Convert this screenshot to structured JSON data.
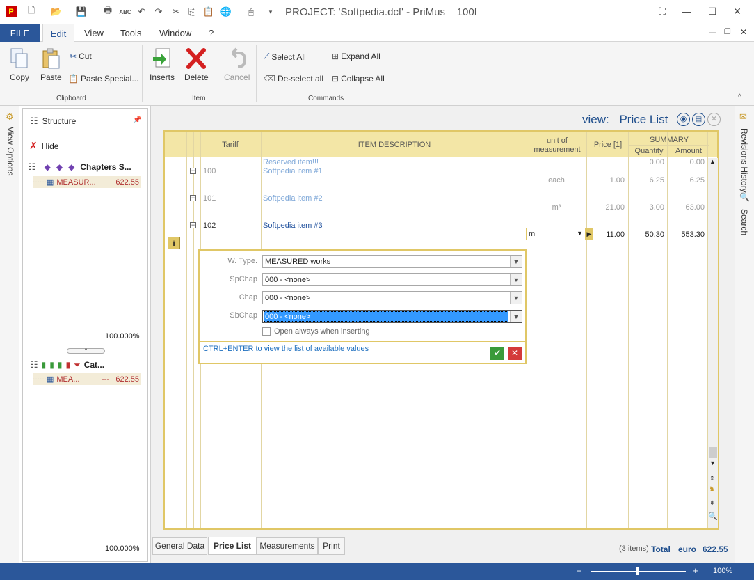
{
  "app": {
    "title": "PROJECT: 'Softpedia.dcf' - PriMus    100f"
  },
  "menu": {
    "file": "FILE",
    "tabs": [
      "Edit",
      "View",
      "Tools",
      "Window",
      "?"
    ]
  },
  "ribbon": {
    "copy": "Copy",
    "paste": "Paste",
    "cut": "Cut",
    "paste_special": "Paste Special...",
    "clipboard_group": "Clipboard",
    "inserts": "Inserts",
    "delete": "Delete",
    "cancel": "Cancel",
    "item_group": "Item",
    "select_all": "Select All",
    "deselect_all": "De-select all",
    "expand_all": "Expand All",
    "collapse_all": "Collapse All",
    "commands_group": "Commands"
  },
  "left_strip": {
    "view_options": "View Options"
  },
  "left_panel": {
    "structure": "Structure",
    "hide": "Hide",
    "chapters": "Chapters S...",
    "measur_label": "MEASUR...",
    "measur_value": "622.55",
    "percent_top": "100.000%",
    "cat": "Cat...",
    "mea_label": "MEA...",
    "mea_dash": "---",
    "mea_value": "622.55",
    "percent_bottom": "100.000%"
  },
  "right_strip": {
    "revisions": "Revisions History",
    "search": "Search"
  },
  "view": {
    "label": "view:",
    "name": "Price List"
  },
  "grid": {
    "headers": {
      "tariff": "Tariff",
      "description": "ITEM DESCRIPTION",
      "unit_line1": "unit of",
      "unit_line2": "measurement",
      "price": "Price [1]",
      "summary": "SUMMARY",
      "quantity": "Quantity",
      "amount": "Amount"
    },
    "rows": [
      {
        "tariff": "",
        "desc": "Reserved item!!!",
        "unit": "",
        "price": "",
        "qty": "0.00",
        "amount": "0.00"
      },
      {
        "tariff": "100",
        "desc": "Softpedia item #1",
        "unit": "each",
        "price": "1.00",
        "qty": "6.25",
        "amount": "6.25"
      },
      {
        "tariff": "101",
        "desc": "Softpedia item #2",
        "unit": "m³",
        "price": "21.00",
        "qty": "3.00",
        "amount": "63.00"
      },
      {
        "tariff": "102",
        "desc": "Softpedia item #3",
        "unit": "m",
        "price": "11.00",
        "qty": "50.30",
        "amount": "553.30"
      }
    ]
  },
  "popup": {
    "wtype_label": "W. Type.",
    "wtype_value": "MEASURED works",
    "spchap_label": "SpChap",
    "spchap_value": "000 - <none>",
    "chap_label": "Chap",
    "chap_value": "000 - <none>",
    "sbchap_label": "SbChap",
    "sbchap_value": "000 - <none>",
    "checkbox_label": "Open always when inserting",
    "hint": "CTRL+ENTER to view the list of available values"
  },
  "bottom_tabs": [
    "General Data",
    "Price List",
    "Measurements",
    "Print"
  ],
  "totals": {
    "items": "(3 items)",
    "total_label": "Total",
    "currency": "euro",
    "value": "622.55"
  },
  "status": {
    "zoom": "100%"
  },
  "colors": {
    "accent": "#2b579a",
    "grid_border": "#e0c766",
    "header_fill": "#f3e6a6",
    "selected": "#3399ff"
  }
}
